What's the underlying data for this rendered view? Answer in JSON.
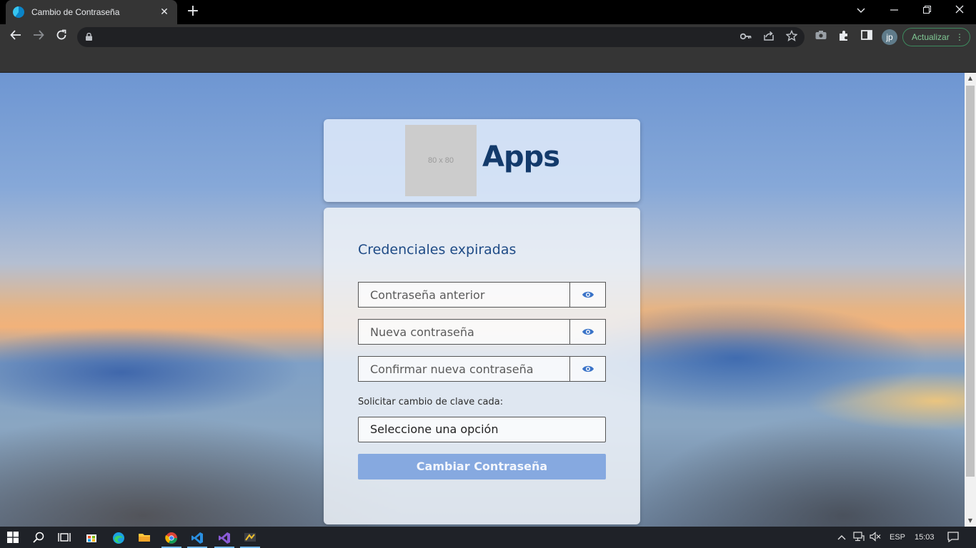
{
  "browser": {
    "tab_title": "Cambio de Contraseña",
    "tab_close": "✕",
    "new_tab": "+",
    "update_label": "Actualizar",
    "update_menu": "⋮",
    "profile_initials": "jp"
  },
  "brand": {
    "logo_placeholder": "80 x 80",
    "name": "Apps"
  },
  "form": {
    "title": "Credenciales expiradas",
    "old_password_placeholder": "Contraseña anterior",
    "new_password_placeholder": "Nueva contraseña",
    "confirm_password_placeholder": "Confirmar nueva contraseña",
    "frequency_label": "Solicitar cambio de clave cada:",
    "frequency_selected": "Seleccione una opción",
    "submit_label": "Cambiar Contraseña"
  },
  "taskbar": {
    "language": "ESP",
    "time": "15:03"
  },
  "colors": {
    "brand_text": "#133a6b",
    "title_text": "#1f4b86",
    "eye_icon": "#3a73c8",
    "submit_bg": "#86a9e0",
    "update_accent": "#81c995"
  }
}
